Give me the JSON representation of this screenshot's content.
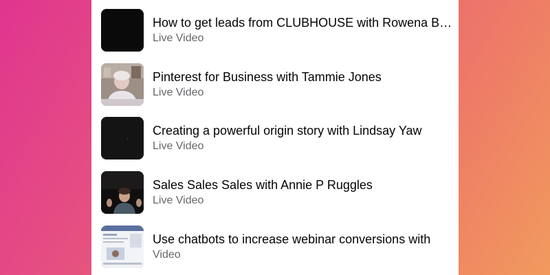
{
  "videos": [
    {
      "title": "How to get leads from CLUBHOUSE with Rowena Bajak",
      "type": "Live Video",
      "thumbnail": "black-frame"
    },
    {
      "title": "Pinterest for Business with Tammie Jones",
      "type": "Live Video",
      "thumbnail": "woman-webcam"
    },
    {
      "title": "Creating a powerful origin story with Lindsay Yaw",
      "type": "Live Video",
      "thumbnail": "dark-frame"
    },
    {
      "title": "Sales Sales Sales with Annie P Ruggles",
      "type": "Live Video",
      "thumbnail": "person-dark-room"
    },
    {
      "title": "Use chatbots to increase webinar conversions with",
      "type": "Video",
      "thumbnail": "screen-share"
    }
  ],
  "colors": {
    "background_start": "#e0358f",
    "background_end": "#f19a5e",
    "panel": "#ffffff",
    "title_text": "#050505",
    "subtitle_text": "#65676b"
  }
}
